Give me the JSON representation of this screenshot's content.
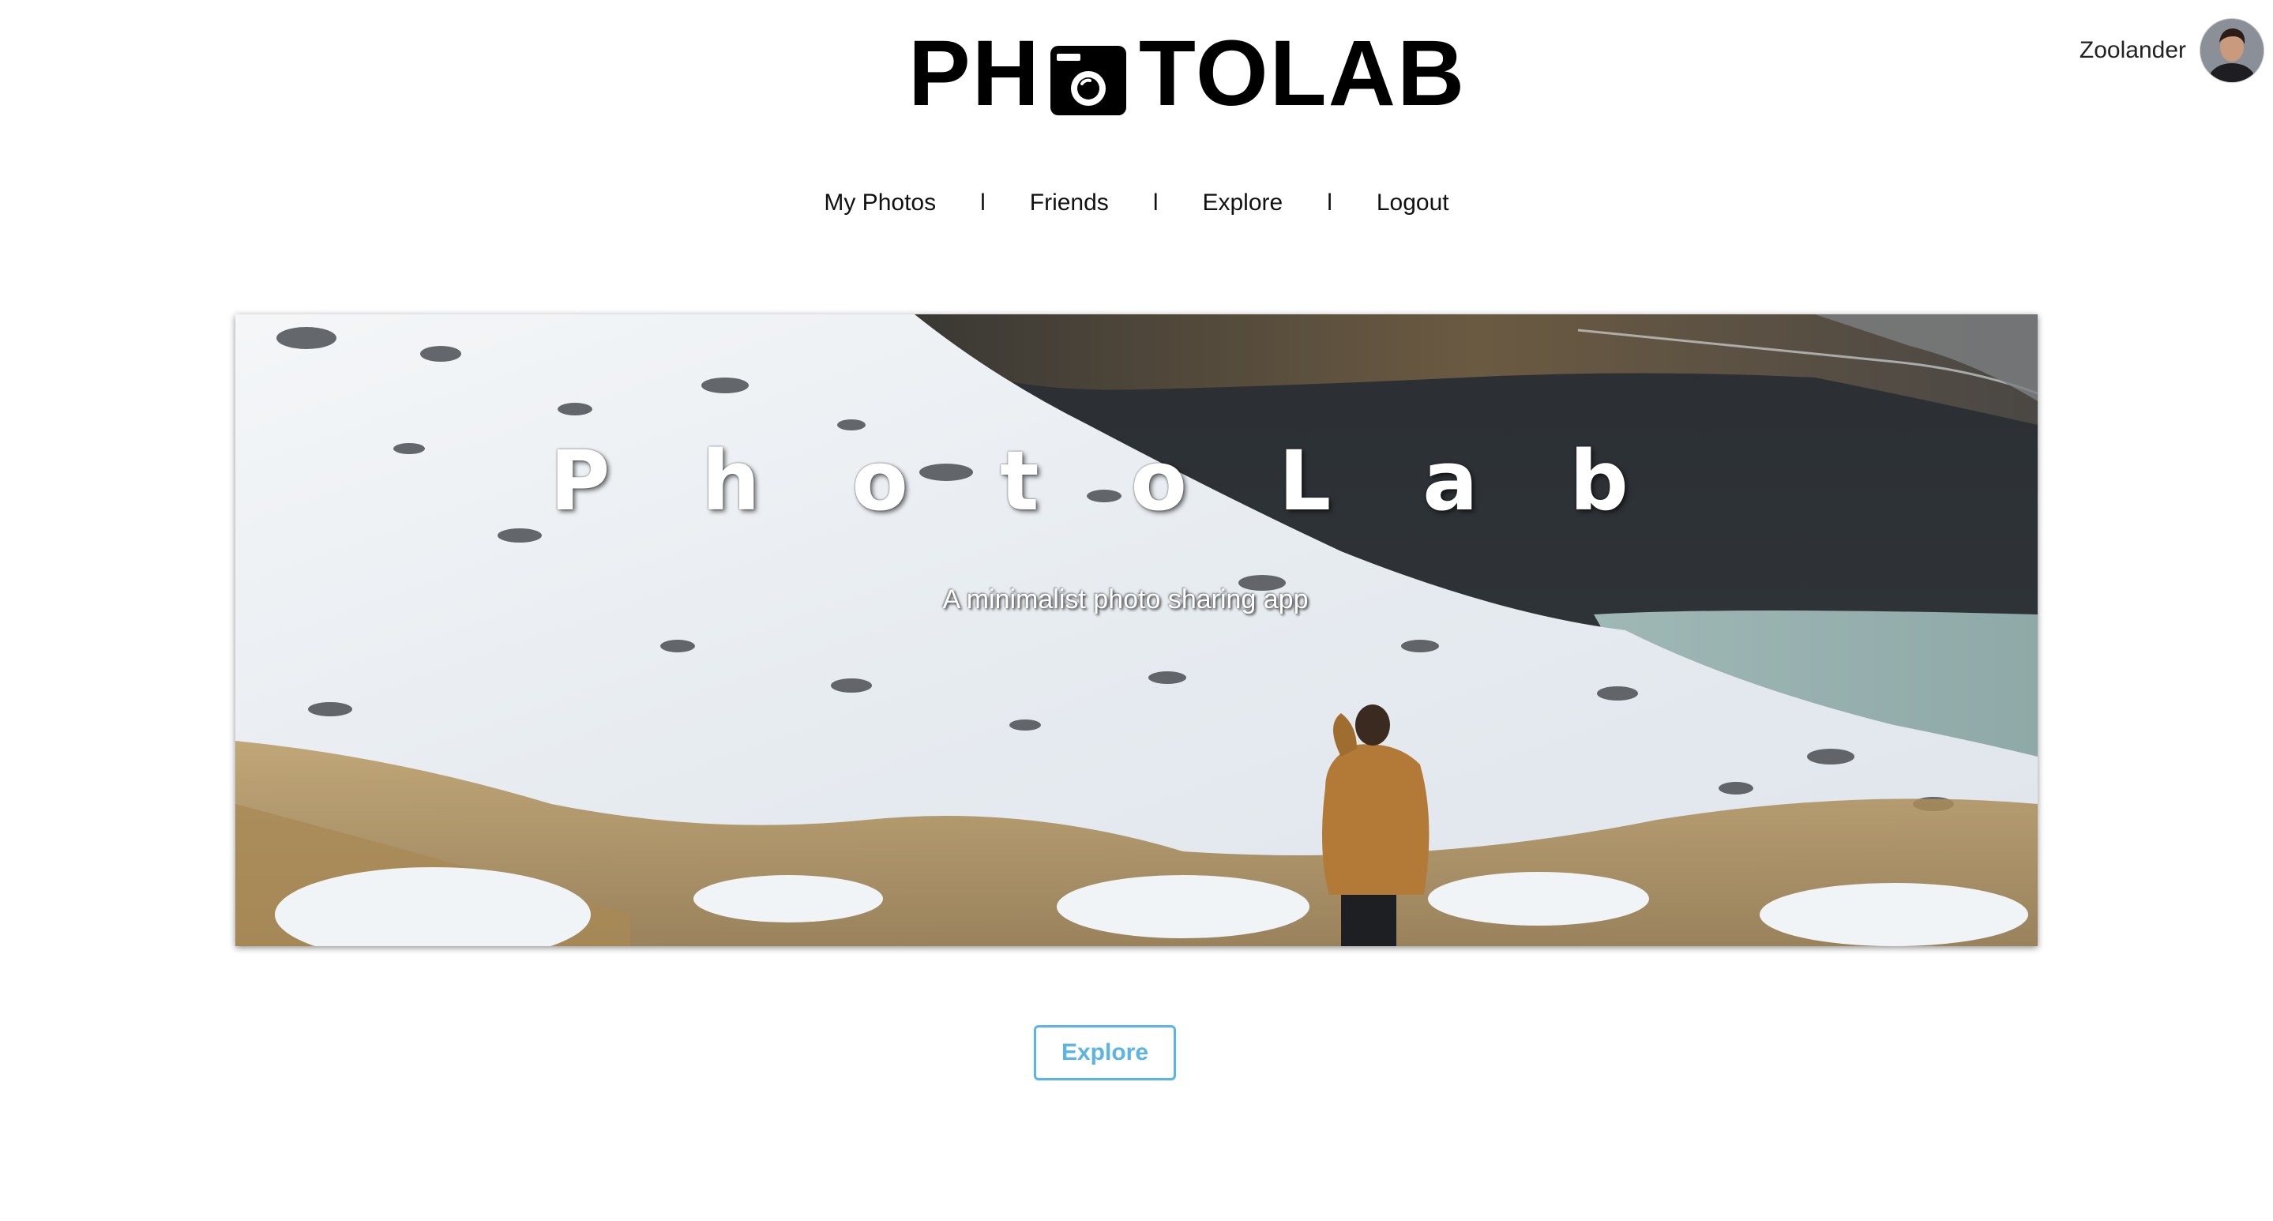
{
  "header": {
    "logo_left": "PH",
    "logo_right": "TOLAB",
    "logo_icon": "camera-icon"
  },
  "user": {
    "name": "Zoolander",
    "avatar_icon": "user-avatar"
  },
  "nav": {
    "items": [
      "My Photos",
      "Friends",
      "Explore",
      "Logout"
    ],
    "separator": "l"
  },
  "hero": {
    "title": "PhotoLab",
    "subtitle": "A minimalist photo sharing app"
  },
  "cta": {
    "label": "Explore"
  },
  "colors": {
    "accent": "#5ab4e6",
    "text": "#111111",
    "background": "#ffffff"
  }
}
